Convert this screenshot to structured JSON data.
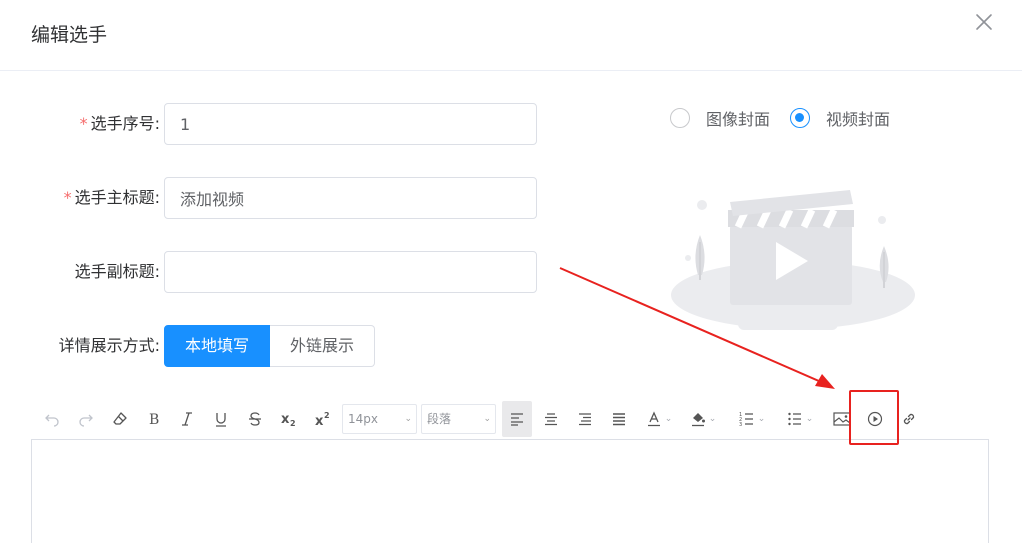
{
  "dialog": {
    "title": "编辑选手"
  },
  "form": {
    "number": {
      "label": "选手序号",
      "value": "1",
      "required": true
    },
    "main_title": {
      "label": "选手主标题",
      "value": "添加视频",
      "required": true
    },
    "subtitle": {
      "label": "选手副标题",
      "value": "",
      "required": false
    },
    "detail_mode": {
      "label": "详情展示方式",
      "options": [
        "本地填写",
        "外链展示"
      ],
      "selected": "本地填写"
    }
  },
  "cover": {
    "options": [
      {
        "label": "图像封面",
        "checked": false
      },
      {
        "label": "视频封面",
        "checked": true
      }
    ]
  },
  "toolbar": {
    "font_size": "14px",
    "paragraph": "段落",
    "icons": [
      "undo-icon",
      "redo-icon",
      "eraser-icon",
      "bold-icon",
      "italic-icon",
      "underline-icon",
      "strikethrough-icon",
      "subscript-icon",
      "superscript-icon",
      "align-left-icon",
      "align-center-icon",
      "align-right-icon",
      "align-justify-icon",
      "font-color-icon",
      "bg-color-icon",
      "ordered-list-icon",
      "unordered-list-icon",
      "image-icon",
      "video-icon",
      "link-icon"
    ]
  },
  "colors": {
    "primary": "#1890ff",
    "required": "#f56c6c",
    "annotation": "#e8221f"
  }
}
